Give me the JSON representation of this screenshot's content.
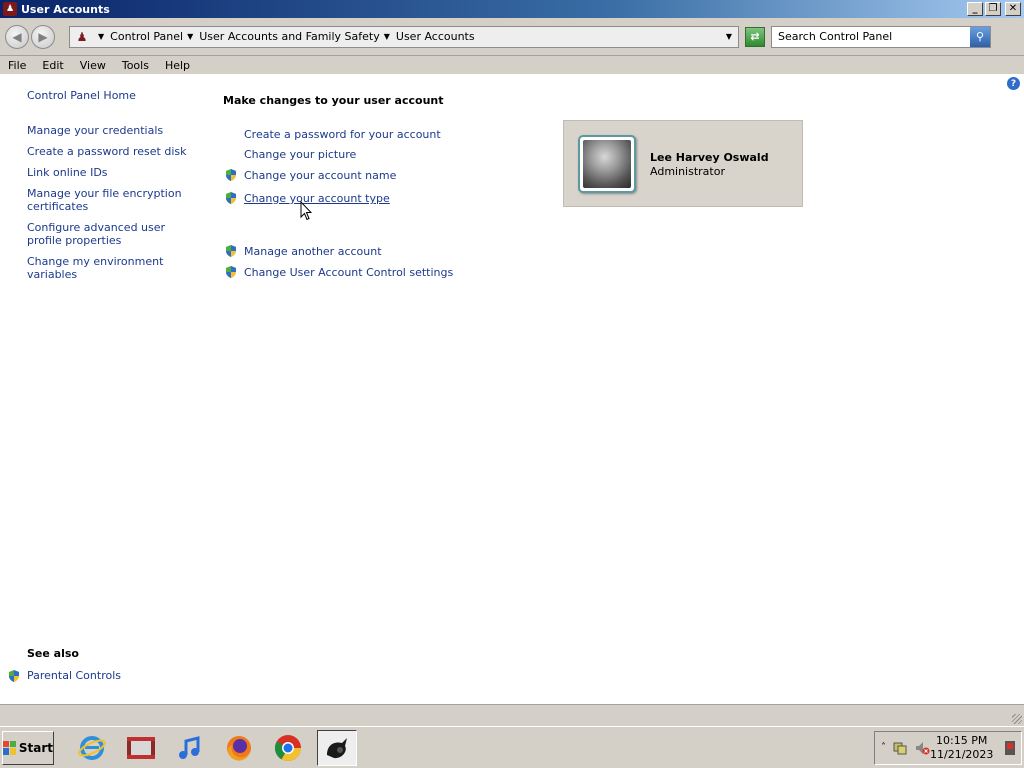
{
  "window": {
    "title": "User Accounts",
    "minimize_label": "_",
    "maximize_label": "❐",
    "close_label": "✕"
  },
  "address": {
    "breadcrumbs": [
      "Control Panel",
      "User Accounts and Family Safety",
      "User Accounts"
    ],
    "search_placeholder": "Search Control Panel"
  },
  "menu": [
    "File",
    "Edit",
    "View",
    "Tools",
    "Help"
  ],
  "sidebar": {
    "home": "Control Panel Home",
    "links": [
      "Manage your credentials",
      "Create a password reset disk",
      "Link online IDs",
      "Manage your file encryption certificates",
      "Configure advanced user profile properties",
      "Change my environment variables"
    ],
    "see_also_title": "See also",
    "see_also_links": [
      "Parental Controls"
    ]
  },
  "main": {
    "heading": "Make changes to your user account",
    "links": [
      "Create a password for your account",
      "Change your picture",
      "Change your account name",
      "Change your account type",
      "Manage another account",
      "Change User Account Control settings"
    ]
  },
  "account": {
    "name": "Lee Harvey Oswald",
    "type": "Administrator"
  },
  "taskbar": {
    "start_label": "Start",
    "apps": [
      "internet-explorer-icon",
      "media-center-icon",
      "itunes-icon",
      "firefox-icon",
      "chrome-icon",
      "winamp-icon"
    ],
    "clock_time": "10:15 PM",
    "clock_date": "11/21/2023"
  },
  "colors": {
    "link": "#1c3a8c",
    "titlebar_start": "#0a246a",
    "titlebar_end": "#a6caf0",
    "chrome_gray": "#d4d0c8"
  }
}
